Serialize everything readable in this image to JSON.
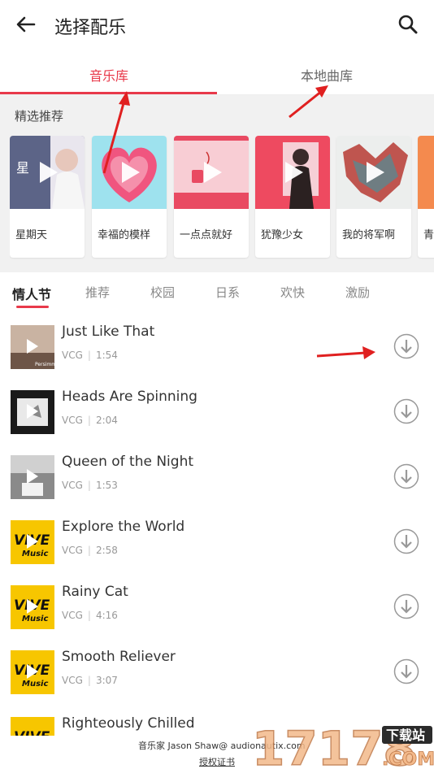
{
  "header": {
    "title": "选择配乐"
  },
  "tabs": [
    {
      "label": "音乐库",
      "active": true
    },
    {
      "label": "本地曲库",
      "active": false
    }
  ],
  "featured": {
    "title": "精选推荐",
    "items": [
      {
        "label": "星期天"
      },
      {
        "label": "幸福的模样"
      },
      {
        "label": "一点点就好"
      },
      {
        "label": "犹豫少女"
      },
      {
        "label": "我的将军啊"
      },
      {
        "label": "青"
      }
    ]
  },
  "categories": [
    {
      "label": "情人节",
      "active": true
    },
    {
      "label": "推荐"
    },
    {
      "label": "校园"
    },
    {
      "label": "日系"
    },
    {
      "label": "欢快"
    },
    {
      "label": "激励"
    }
  ],
  "songs": [
    {
      "title": "Just Like That",
      "artist": "VCG",
      "duration": "1:54"
    },
    {
      "title": "Heads Are Spinning",
      "artist": "VCG",
      "duration": "2:04"
    },
    {
      "title": "Queen of the Night",
      "artist": "VCG",
      "duration": "1:53"
    },
    {
      "title": "Explore the World",
      "artist": "VCG",
      "duration": "2:58"
    },
    {
      "title": "Rainy Cat",
      "artist": "VCG",
      "duration": "4:16"
    },
    {
      "title": "Smooth Reliever",
      "artist": "VCG",
      "duration": "3:07"
    },
    {
      "title": "Righteously Chilled"
    }
  ],
  "footer": {
    "credit": "音乐家 Jason Shaw@ audionautix.com",
    "license": "授权证书"
  },
  "watermark": {
    "site": "17178",
    "tag": "下载站",
    "domain": ".COM"
  },
  "colors": {
    "accent": "#e8394a",
    "annotation_arrow": "#e02020",
    "thumb_yellow": "#f7c600"
  }
}
